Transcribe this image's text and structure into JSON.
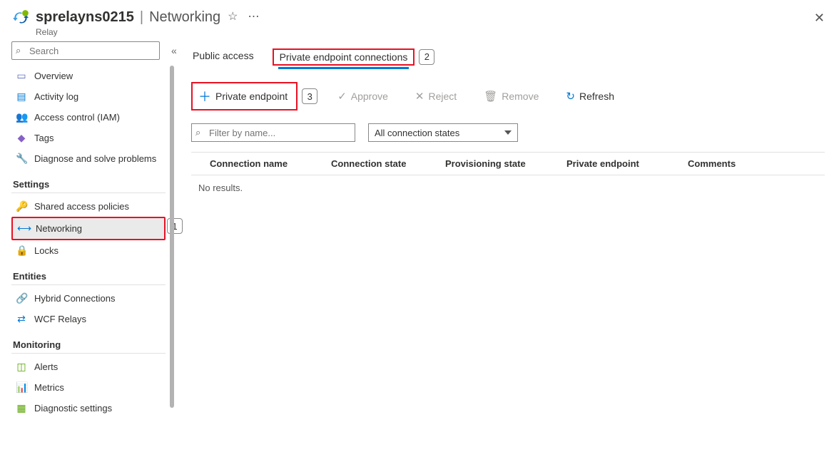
{
  "header": {
    "resource_name": "sprelayns0215",
    "blade_title": "Networking",
    "subtitle": "Relay"
  },
  "sidebar": {
    "search_placeholder": "Search",
    "items_top": [
      {
        "icon": "overview",
        "label": "Overview",
        "color": "#5c6bc0"
      },
      {
        "icon": "activity",
        "label": "Activity log",
        "color": "#0078d4"
      },
      {
        "icon": "iam",
        "label": "Access control (IAM)",
        "color": "#0078d4"
      },
      {
        "icon": "tags",
        "label": "Tags",
        "color": "#8661c5"
      },
      {
        "icon": "diagnose",
        "label": "Diagnose and solve problems",
        "color": "#555"
      }
    ],
    "section_settings": "Settings",
    "items_settings": [
      {
        "icon": "key",
        "label": "Shared access policies",
        "color": "#ffb900"
      },
      {
        "icon": "net",
        "label": "Networking",
        "color": "#0078d4",
        "selected": true
      },
      {
        "icon": "lock",
        "label": "Locks",
        "color": "#0078d4"
      }
    ],
    "section_entities": "Entities",
    "items_entities": [
      {
        "icon": "hybrid",
        "label": "Hybrid Connections",
        "color": "#0078d4"
      },
      {
        "icon": "wcf",
        "label": "WCF Relays",
        "color": "#0078d4"
      }
    ],
    "section_monitoring": "Monitoring",
    "items_monitoring": [
      {
        "icon": "alerts",
        "label": "Alerts",
        "color": "#57a300"
      },
      {
        "icon": "metrics",
        "label": "Metrics",
        "color": "#0078d4"
      },
      {
        "icon": "diag",
        "label": "Diagnostic settings",
        "color": "#57a300"
      }
    ]
  },
  "tabs": {
    "public": "Public access",
    "private": "Private endpoint connections"
  },
  "commands": {
    "add": "Private endpoint",
    "approve": "Approve",
    "reject": "Reject",
    "remove": "Remove",
    "refresh": "Refresh"
  },
  "filters": {
    "filter_placeholder": "Filter by name...",
    "state_selected": "All connection states"
  },
  "grid": {
    "headers": {
      "conn": "Connection name",
      "cstate": "Connection state",
      "pstate": "Provisioning state",
      "pendpoint": "Private endpoint",
      "comments": "Comments"
    },
    "empty": "No results."
  },
  "callouts": {
    "one": "1",
    "two": "2",
    "three": "3"
  }
}
